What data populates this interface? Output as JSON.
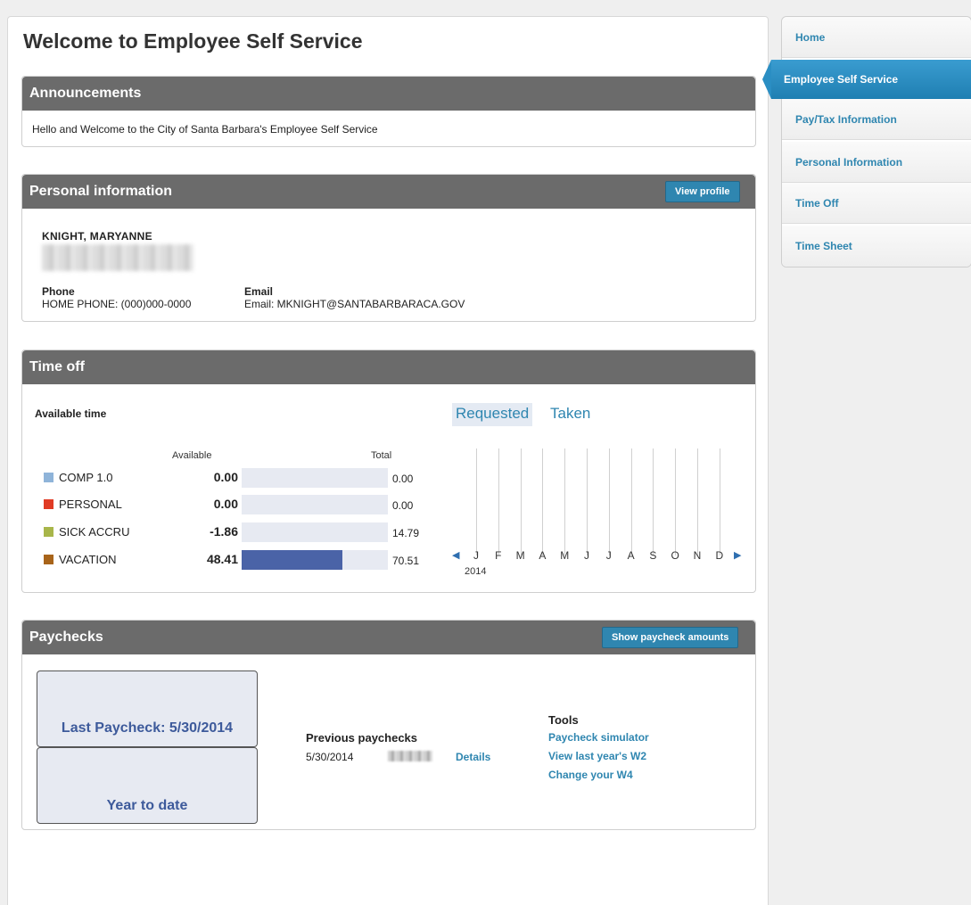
{
  "page": {
    "title": "Welcome to Employee Self Service"
  },
  "announcements": {
    "title": "Announcements",
    "text": "Hello and Welcome to the City of Santa Barbara's Employee Self Service"
  },
  "personal": {
    "title": "Personal information",
    "view_profile_label": "View profile",
    "name": "KNIGHT, MARYANNE",
    "phone_label": "Phone",
    "phone_value": "HOME PHONE: (000)000-0000",
    "email_label": "Email",
    "email_value": "Email: MKNIGHT@SANTABARBARACA.GOV"
  },
  "timeoff": {
    "title": "Time off",
    "available_title": "Available time",
    "col_available": "Available",
    "col_total": "Total",
    "rows": [
      {
        "name": "COMP 1.0",
        "available": "0.00",
        "total": "0.00",
        "available_fraction": 0,
        "color": "#8fb4d9"
      },
      {
        "name": "PERSONAL",
        "available": "0.00",
        "total": "0.00",
        "available_fraction": 0,
        "color": "#e03b24"
      },
      {
        "name": "SICK ACCRU",
        "available": "-1.86",
        "total": "14.79",
        "available_fraction": 0,
        "color": "#a8b64a"
      },
      {
        "name": "VACATION",
        "available": "48.41",
        "total": "70.51",
        "available_fraction": 0.6866,
        "color": "#a8641a"
      }
    ],
    "tab_requested": "Requested",
    "tab_taken": "Taken",
    "months": [
      "J",
      "F",
      "M",
      "A",
      "M",
      "J",
      "J",
      "A",
      "S",
      "O",
      "N",
      "D"
    ],
    "year": "2014",
    "prev_arrow": "◀",
    "next_arrow": "▶"
  },
  "paychecks": {
    "title": "Paychecks",
    "show_amounts_label": "Show paycheck amounts",
    "last_paycheck": "Last Paycheck: 5/30/2014",
    "year_to_date": "Year to date",
    "previous_title": "Previous paychecks",
    "previous_date": "5/30/2014",
    "details_label": "Details",
    "tools_title": "Tools",
    "tools": [
      "Paycheck simulator",
      "View last year's W2",
      "Change your W4"
    ]
  },
  "nav": {
    "items": [
      "Home",
      "Employee Self Service",
      "Pay/Tax Information",
      "Personal Information",
      "Time Off",
      "Time Sheet"
    ],
    "active_index": 1
  }
}
